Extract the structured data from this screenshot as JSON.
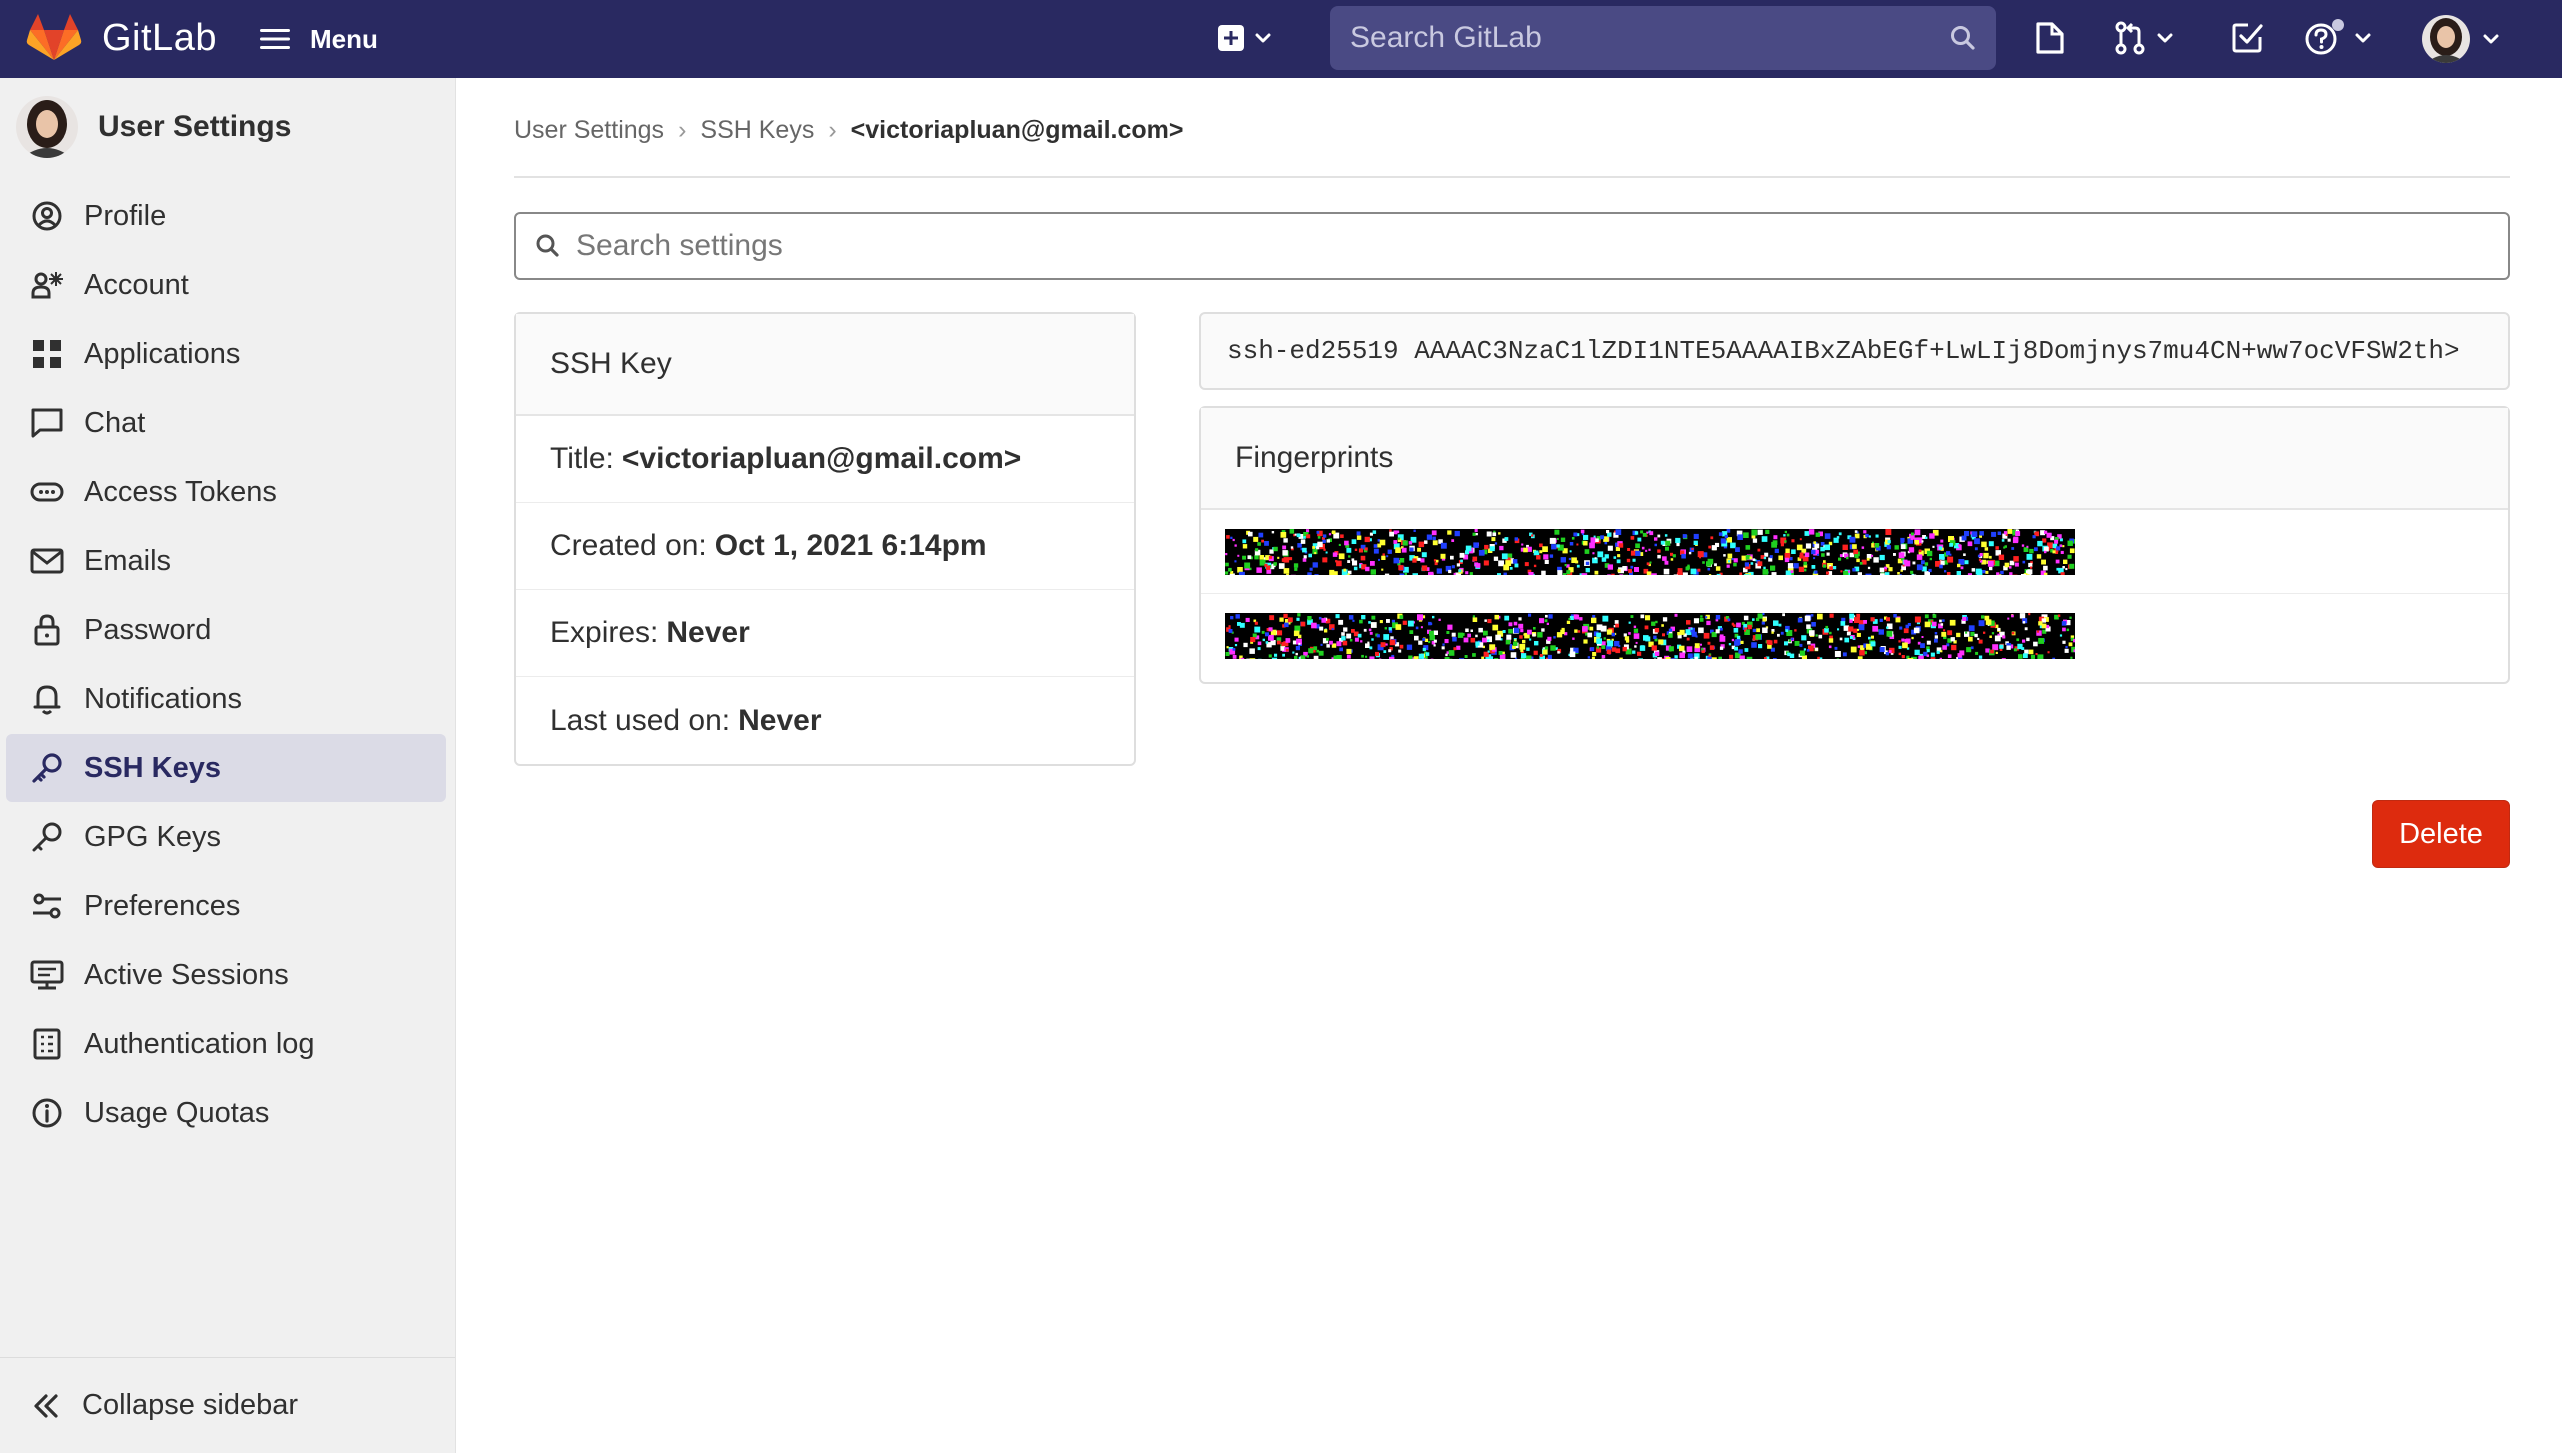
{
  "topbar": {
    "brand_name": "GitLab",
    "menu_label": "Menu",
    "search_placeholder": "Search GitLab",
    "colors": {
      "bg": "#292961",
      "search_bg": "#4a4a84"
    }
  },
  "sidebar": {
    "title": "User Settings",
    "items": [
      {
        "label": "Profile",
        "icon": "profile-icon"
      },
      {
        "label": "Account",
        "icon": "account-icon"
      },
      {
        "label": "Applications",
        "icon": "applications-icon"
      },
      {
        "label": "Chat",
        "icon": "chat-icon"
      },
      {
        "label": "Access Tokens",
        "icon": "token-icon"
      },
      {
        "label": "Emails",
        "icon": "mail-icon"
      },
      {
        "label": "Password",
        "icon": "lock-icon"
      },
      {
        "label": "Notifications",
        "icon": "bell-icon"
      },
      {
        "label": "SSH Keys",
        "icon": "key-icon",
        "active": true
      },
      {
        "label": "GPG Keys",
        "icon": "key-icon"
      },
      {
        "label": "Preferences",
        "icon": "preferences-icon"
      },
      {
        "label": "Active Sessions",
        "icon": "monitor-icon"
      },
      {
        "label": "Authentication log",
        "icon": "log-icon"
      },
      {
        "label": "Usage Quotas",
        "icon": "quota-icon"
      }
    ],
    "collapse_label": "Collapse sidebar"
  },
  "breadcrumb": {
    "items": [
      "User Settings",
      "SSH Keys",
      "<victoriapluan@gmail.com>"
    ]
  },
  "settings_search": {
    "placeholder": "Search settings"
  },
  "ssh_key_card": {
    "header": "SSH Key",
    "title_label": "Title:",
    "title_value": "<victoriapluan@gmail.com>",
    "created_label": "Created on:",
    "created_value": "Oct 1, 2021 6:14pm",
    "expires_label": "Expires:",
    "expires_value": "Never",
    "last_used_label": "Last used on:",
    "last_used_value": "Never"
  },
  "ssh_key_text": "ssh-ed25519 AAAAC3NzaC1lZDI1NTE5AAAAIBxZAbEGf+LwLIj8Domjnys7mu4CN+ww7ocVFSW2th>",
  "fingerprints": {
    "header": "Fingerprints"
  },
  "actions": {
    "delete_label": "Delete",
    "delete_color": "#dd2b0e"
  }
}
